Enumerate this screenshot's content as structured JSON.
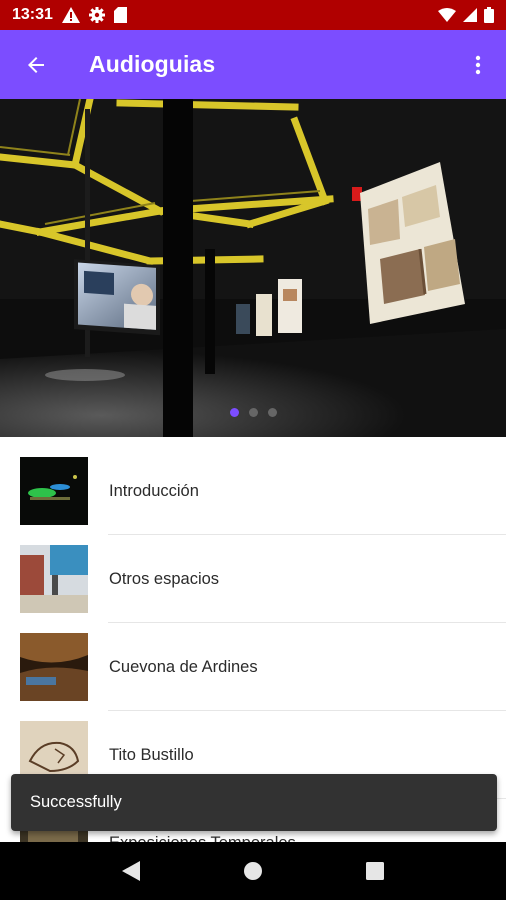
{
  "status_bar": {
    "time": "13:31",
    "icons": [
      "alert-icon",
      "gear-icon",
      "sd-card-icon",
      "wifi-icon",
      "signal-icon",
      "battery-icon"
    ]
  },
  "app_bar": {
    "title": "Audioguias",
    "back_icon": "arrow-back-icon",
    "menu_icon": "more-vert-icon",
    "color": "#7c4dff"
  },
  "carousel": {
    "page_count": 3,
    "active_index": 0,
    "indicator_active_color": "#7c4dff"
  },
  "list": {
    "items": [
      {
        "label": "Introducción"
      },
      {
        "label": "Otros espacios"
      },
      {
        "label": "Cuevona de Ardines"
      },
      {
        "label": "Tito Bustillo"
      },
      {
        "label": "Exposiciones Temporales"
      }
    ]
  },
  "snackbar": {
    "message": "Successfully"
  },
  "nav_bar": {
    "buttons": [
      "back-triangle-icon",
      "home-circle-icon",
      "recents-square-icon"
    ]
  },
  "colors": {
    "status_bar": "#b00000",
    "app_bar": "#7c4dff",
    "snackbar": "#323232"
  }
}
